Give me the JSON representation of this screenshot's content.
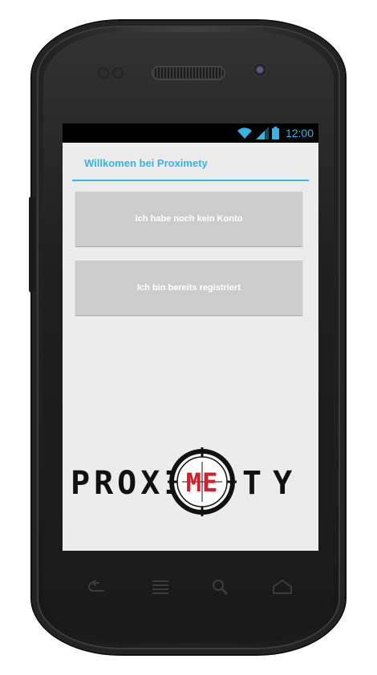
{
  "device": {
    "name": "Android phone frame"
  },
  "status_bar": {
    "time": "12:00",
    "icons": [
      "wifi-icon",
      "signal-icon",
      "battery-icon"
    ],
    "accent": "#33b5e5"
  },
  "screen": {
    "title": "Willkomen bei Proximety",
    "buttons": [
      {
        "label": "Ich habe noch kein Konto"
      },
      {
        "label": "Ich bin bereits registriert"
      }
    ],
    "logo": {
      "left": "PROXI",
      "center": "ME",
      "right": "TY",
      "center_color": "#d81e2b"
    }
  },
  "nav_keys": [
    "back-icon",
    "menu-icon",
    "search-icon",
    "home-icon"
  ],
  "colors": {
    "screen_bg": "#ececec",
    "button_bg": "#cccccc",
    "button_text": "#ffffff"
  }
}
